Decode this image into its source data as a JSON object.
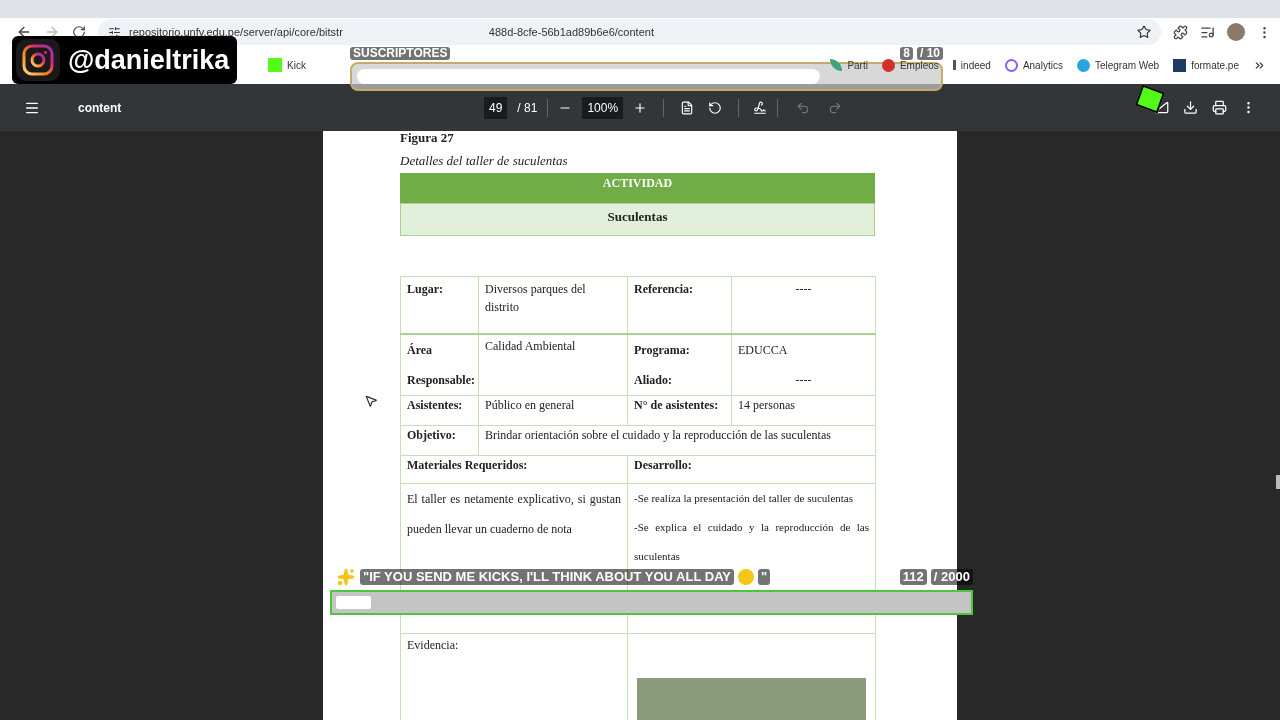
{
  "browser": {
    "url_start": "repositorio.unfv.edu.pe/server/api/core/bitstr",
    "url_end": "488d-8cfe-56b1ad89b6e6/content",
    "forward_disabled": true
  },
  "bookmarks": [
    {
      "label": "Kick",
      "kind": "kick"
    },
    {
      "label": "Parti",
      "kind": "leaf"
    },
    {
      "label": "Empleos",
      "kind": "red"
    },
    {
      "label": "indeed",
      "kind": "plain"
    },
    {
      "label": "Analytics",
      "kind": "analytics"
    },
    {
      "label": "Telegram Web",
      "kind": "telegram"
    },
    {
      "label": "formate.pe",
      "kind": "square"
    }
  ],
  "pdf_toolbar": {
    "title": "content",
    "page": "49",
    "page_total": "/ 81",
    "zoom": "100%",
    "undo_disabled": true,
    "redo_disabled": true
  },
  "document": {
    "figure_label": "Figura 27",
    "caption": "Detalles del taller de suculentas",
    "header": "ACTIVIDAD",
    "activity": "Suculentas",
    "lugar": {
      "label": "Lugar:",
      "value": "Diversos parques del distrito",
      "ref_label": "Referencia:",
      "ref_value": "----"
    },
    "area": {
      "label": "Área Responsable:",
      "value": "Calidad Ambiental",
      "programa_label": "Programa:",
      "programa_value": "EDUCCA",
      "aliado_label": "Aliado:",
      "aliado_value": "----"
    },
    "asistentes": {
      "label": "Asistentes:",
      "value": "Público en general",
      "count_label": "N° de asistentes:",
      "count_value": "14 personas"
    },
    "objetivo": {
      "label": "Objetivo:",
      "value": "Brindar orientación sobre el cuidado y la reproducción de las suculentas"
    },
    "materiales_label": "Materiales Requeridos:",
    "desarrollo_label": "Desarrollo:",
    "materiales": "El taller es netamente explicativo, si gustan pueden llevar un cuaderno de nota",
    "desarrollo": [
      "-Se realiza la presentación del taller de suculentas",
      "-Se explica el cuidado y la reproducción de las suculentas"
    ],
    "evidencia_label": "Evidencia:"
  },
  "overlays": {
    "handle": "@danieltrika",
    "subs_label": "SUSCRIPTORES",
    "subs_current": "8",
    "subs_goal": "/ 10",
    "kicks_quote": "\"IF YOU SEND ME KICKS, I'LL THINK ABOUT YOU ALL DAY",
    "kicks_quote_end": "\"",
    "kicks_current": "112",
    "kicks_goal": "/ 2000"
  }
}
